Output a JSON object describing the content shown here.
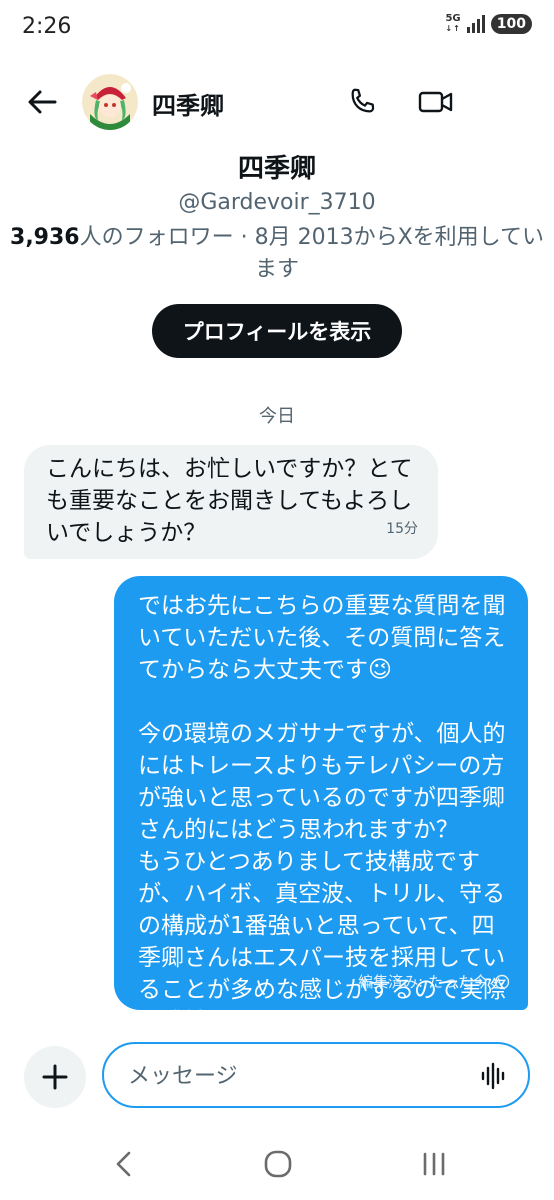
{
  "status_bar": {
    "time": "2:26",
    "network_label": "5G",
    "battery_level": "100"
  },
  "header": {
    "display_name": "四季卿",
    "icons": [
      "back-arrow-icon",
      "phone-icon",
      "video-camera-icon"
    ]
  },
  "profile": {
    "name": "四季卿",
    "handle": "@Gardevoir_3710",
    "follower_count": "3,936",
    "meta_suffix": "人のフォロワー · 8月 2013からXを利用しています",
    "view_profile_label": "プロフィールを表示"
  },
  "conversation": {
    "date_label": "今日",
    "messages": [
      {
        "direction": "incoming",
        "text": "こんにちは、お忙しいですか？とても重要なことをお聞きしてもよろしいでしょうか？",
        "time": "15分"
      },
      {
        "direction": "outgoing",
        "text": "ではお先にこちらの重要な質問を聞いていただいた後、その質問に答えてからなら大丈夫です😉\n\n今の環境のメガサナですが、個人的にはトレースよりもテレパシーの方が強いと思っているのですが四季卿さん的にはどう思われますか？\nもうひとつありまして技構成ですが、ハイボ、真空波、トリル、守るの構成が1番強いと思っていて、四季卿さんはエスパー技を採用していることが多めな感じがするので実際の感触をお聞きしたいです…！",
        "status": "編集済み: たった今"
      }
    ]
  },
  "composer": {
    "placeholder": "メッセージ",
    "icons": [
      "plus-icon",
      "voice-wave-icon"
    ]
  },
  "colors": {
    "accent": "#1d9bf0",
    "incoming_bubble": "#eff3f4",
    "primary_button": "#0f1419",
    "secondary_text": "#536471"
  }
}
